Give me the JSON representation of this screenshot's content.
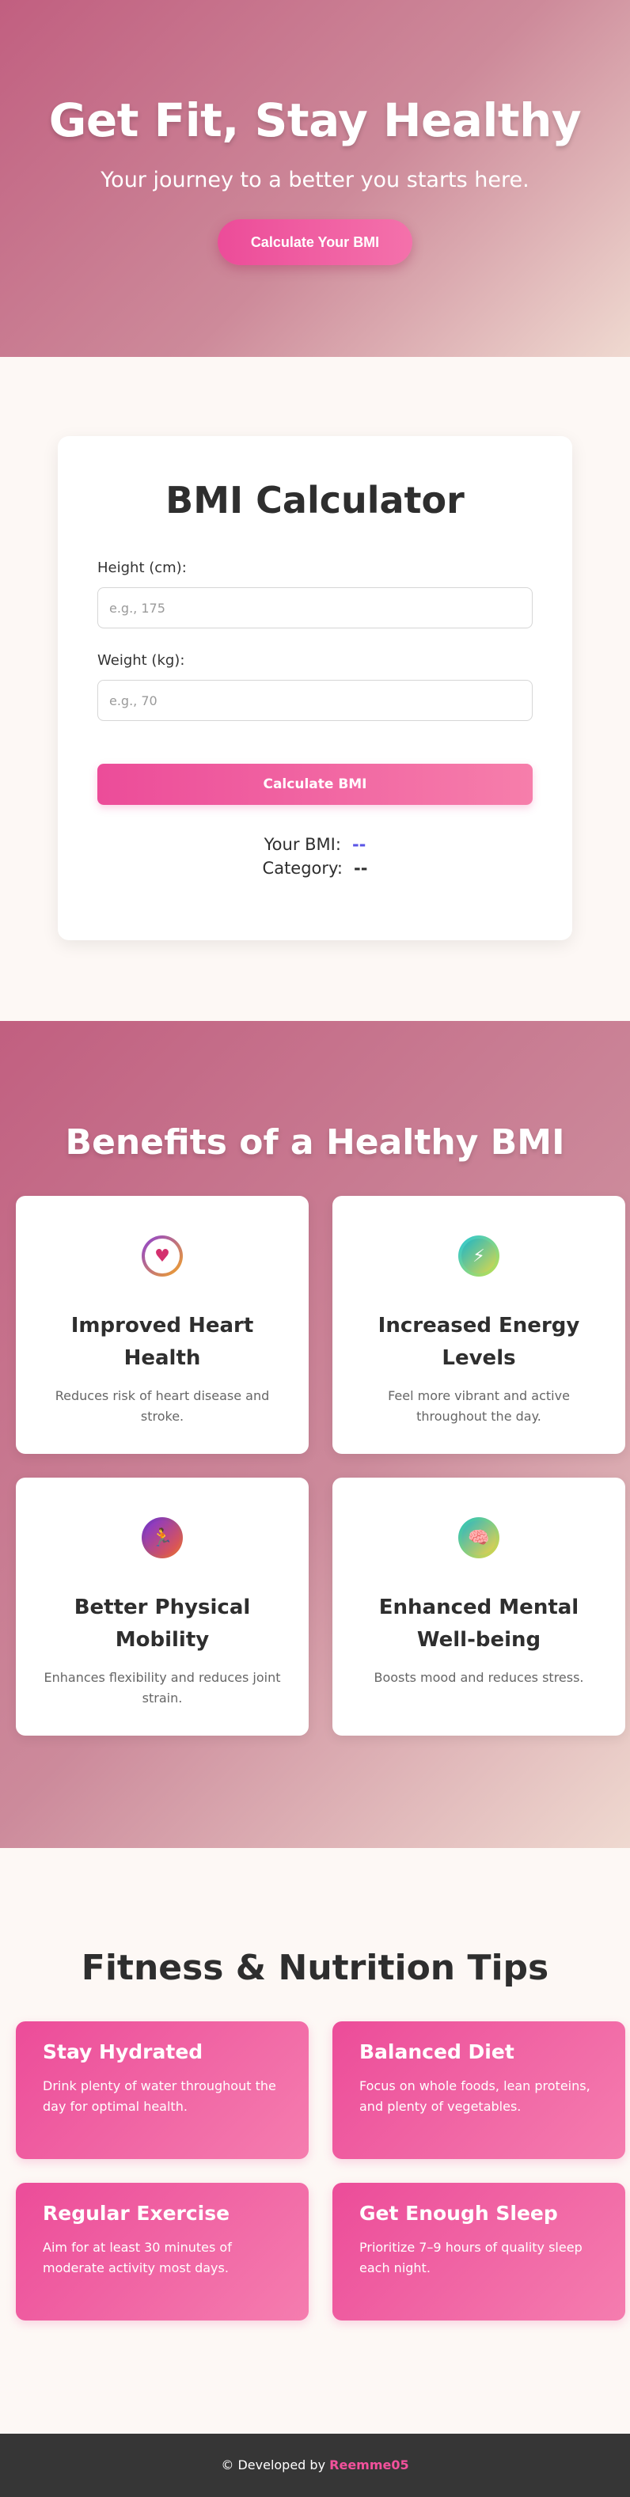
{
  "hero": {
    "title": "Get Fit, Stay Healthy",
    "subtitle": "Your journey to a better you starts here.",
    "cta_label": "Calculate Your BMI"
  },
  "calculator": {
    "title": "BMI Calculator",
    "height_label": "Height (cm):",
    "height_placeholder": "e.g., 175",
    "height_value": "",
    "weight_label": "Weight (kg):",
    "weight_placeholder": "e.g., 70",
    "weight_value": "",
    "button_label": "Calculate BMI",
    "bmi_label": "Your BMI:",
    "bmi_value": "--",
    "category_label": "Category:",
    "category_value": "--",
    "colors": {
      "bmi_value": "#5a55e6",
      "accent": "#ec4c99"
    }
  },
  "benefits": {
    "title": "Benefits of a Healthy BMI",
    "items": [
      {
        "icon": "heart-pulse-icon",
        "title": "Improved Heart Health",
        "text": "Reduces risk of heart disease and stroke."
      },
      {
        "icon": "lightning-icon",
        "title": "Increased Energy Levels",
        "text": "Feel more vibrant and active throughout the day."
      },
      {
        "icon": "runner-icon",
        "title": "Better Physical Mobility",
        "text": "Enhances flexibility and reduces joint strain."
      },
      {
        "icon": "brain-icon",
        "title": "Enhanced Mental Well-being",
        "text": "Boosts mood and reduces stress."
      }
    ]
  },
  "tips": {
    "title": "Fitness & Nutrition Tips",
    "items": [
      {
        "title": "Stay Hydrated",
        "text": "Drink plenty of water throughout the day for optimal health."
      },
      {
        "title": "Balanced Diet",
        "text": "Focus on whole foods, lean proteins, and plenty of vegetables."
      },
      {
        "title": "Regular Exercise",
        "text": "Aim for at least 30 minutes of moderate activity most days."
      },
      {
        "title": "Get Enough Sleep",
        "text": "Prioritize 7–9 hours of quality sleep each night."
      }
    ]
  },
  "footer": {
    "copyright_symbol": "©",
    "text": "Developed by",
    "brand": "Reemme05"
  }
}
